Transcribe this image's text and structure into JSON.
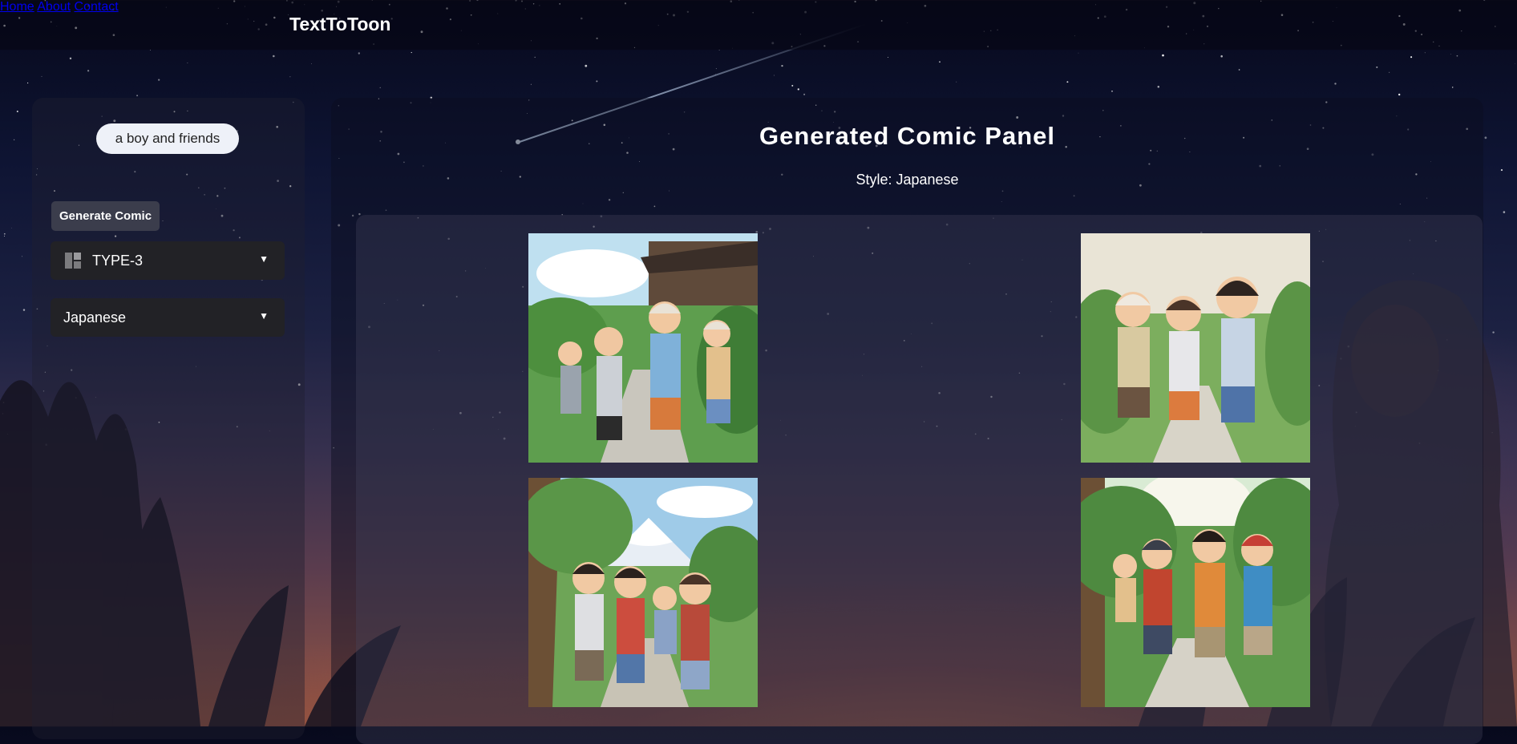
{
  "header": {
    "brand": "TextToToon",
    "nav": [
      {
        "label": "Home"
      },
      {
        "label": "About"
      },
      {
        "label": "Contact"
      }
    ]
  },
  "sidebar": {
    "prompt_value": "a boy and friends",
    "generate_label": "Generate Comic",
    "layout_select": {
      "value": "TYPE-3",
      "icon": "layout-grid-icon"
    },
    "style_select": {
      "value": "Japanese"
    }
  },
  "main": {
    "title": "Generated Comic Panel",
    "style_line": "Style: Japanese",
    "panels": [
      {
        "name": "comic-panel-1"
      },
      {
        "name": "comic-panel-2"
      },
      {
        "name": "comic-panel-3"
      },
      {
        "name": "comic-panel-4"
      }
    ]
  },
  "colors": {
    "nav_bg": "#05061280",
    "select_bg": "#222226",
    "button_bg": "#3b3d4c",
    "prompt_bg": "#eef1f8"
  }
}
